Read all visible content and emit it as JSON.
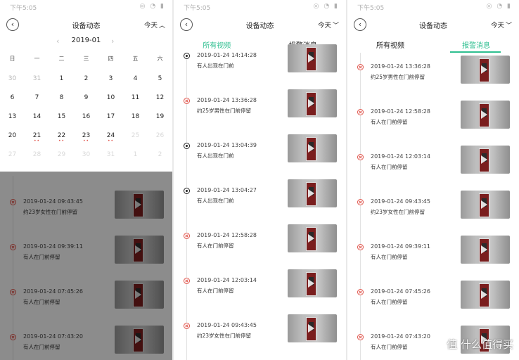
{
  "status": {
    "time": "下午5:05",
    "icons": "◎ ◔ ▮"
  },
  "header": {
    "title": "设备动态",
    "filter": "今天",
    "back_icon": "back-icon"
  },
  "tabs": {
    "all_videos": "所有视频",
    "alarm_messages": "报警消息"
  },
  "calendar": {
    "month": "2019-01",
    "weekdays": [
      "日",
      "一",
      "二",
      "三",
      "四",
      "五",
      "六"
    ],
    "rows": [
      [
        "30",
        "31",
        "1",
        "2",
        "3",
        "4",
        "5"
      ],
      [
        "6",
        "7",
        "8",
        "9",
        "10",
        "11",
        "12"
      ],
      [
        "13",
        "14",
        "15",
        "16",
        "17",
        "18",
        "19"
      ],
      [
        "20",
        "21",
        "22",
        "23",
        "24",
        "25",
        "26"
      ],
      [
        "27",
        "28",
        "29",
        "30",
        "31",
        "1",
        "2"
      ]
    ],
    "dots": "••"
  },
  "panel1_events": [
    {
      "time": "2019-01-24  09:43:45",
      "desc": "约23岁女性在门前停留",
      "type": "alarm"
    },
    {
      "time": "2019-01-24  09:39:11",
      "desc": "有人在门前停留",
      "type": "alarm"
    },
    {
      "time": "2019-01-24  07:45:26",
      "desc": "有人在门前停留",
      "type": "alarm"
    },
    {
      "time": "2019-01-24  07:43:20",
      "desc": "有人在门前停留",
      "type": "alarm"
    }
  ],
  "panel2_events": [
    {
      "time": "2019-01-24  14:14:28",
      "desc": "有人出现在门前",
      "type": "motion"
    },
    {
      "time": "2019-01-24  13:36:28",
      "desc": "约25岁男性在门前停留",
      "type": "alarm"
    },
    {
      "time": "2019-01-24  13:04:39",
      "desc": "有人出现在门前",
      "type": "motion"
    },
    {
      "time": "2019-01-24  13:04:27",
      "desc": "有人出现在门前",
      "type": "motion"
    },
    {
      "time": "2019-01-24  12:58:28",
      "desc": "有人在门前停留",
      "type": "alarm"
    },
    {
      "time": "2019-01-24  12:03:14",
      "desc": "有人在门前停留",
      "type": "alarm"
    },
    {
      "time": "2019-01-24  09:43:45",
      "desc": "约23岁女性在门前停留",
      "type": "alarm"
    }
  ],
  "panel3_events": [
    {
      "time": "2019-01-24  13:36:28",
      "desc": "约25岁男性在门前停留",
      "type": "alarm"
    },
    {
      "time": "2019-01-24  12:58:28",
      "desc": "有人在门前停留",
      "type": "alarm"
    },
    {
      "time": "2019-01-24  12:03:14",
      "desc": "有人在门前停留",
      "type": "alarm"
    },
    {
      "time": "2019-01-24  09:43:45",
      "desc": "约23岁女性在门前停留",
      "type": "alarm"
    },
    {
      "time": "2019-01-24  09:39:11",
      "desc": "有人在门前停留",
      "type": "alarm"
    },
    {
      "time": "2019-01-24  07:45:26",
      "desc": "有人在门前停留",
      "type": "alarm"
    },
    {
      "time": "2019-01-24  07:43:20",
      "desc": "有人在门前停留",
      "type": "alarm"
    }
  ],
  "watermark": "值 什么值得买"
}
